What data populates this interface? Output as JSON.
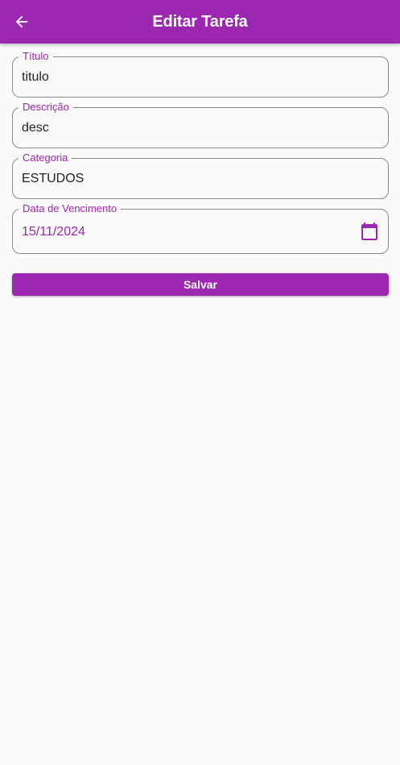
{
  "app_bar": {
    "title": "Editar Tarefa",
    "back_icon": "arrow-back-icon",
    "background": "#9c27b0"
  },
  "form": {
    "fields": [
      {
        "label": "Título",
        "value": "titulo"
      },
      {
        "label": "Descrição",
        "value": "desc"
      },
      {
        "label": "Categoria",
        "value": "ESTUDOS"
      },
      {
        "label": "Data de Vencimento",
        "value": "15/11/2024",
        "icon": "calendar-icon"
      }
    ],
    "save_label": "Salvar"
  },
  "colors": {
    "accent": "#9c27b0",
    "background": "#fafafa",
    "border": "#8a8a8a",
    "text": "#222222"
  }
}
